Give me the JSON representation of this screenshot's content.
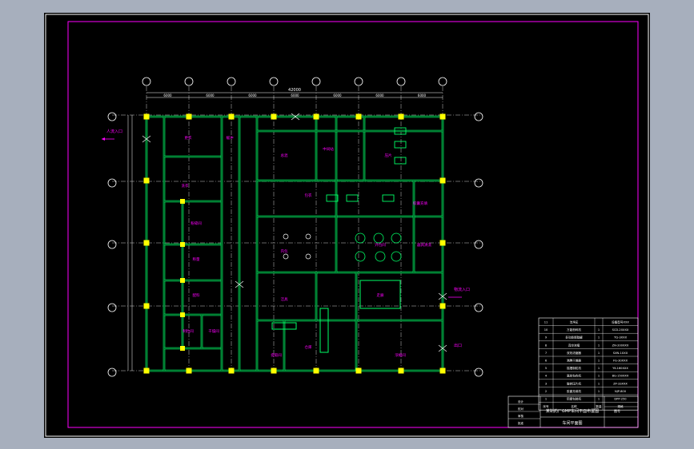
{
  "drawing": {
    "title_block": {
      "main_title": "某制药厂GMP车间平面布置图",
      "sub_title": "车间平面图",
      "sheet_label": "图号",
      "rows": [
        "设计",
        "校对",
        "审核",
        "批准"
      ]
    },
    "equipment_list": {
      "rows": [
        [
          "11",
          "洁净区",
          "",
          "设备型号XXX"
        ],
        [
          "10",
          "万能粉碎机",
          "1",
          "SCD-20XXX"
        ],
        [
          "9",
          "多功能提取罐",
          "1",
          "TQ-3XXX"
        ],
        [
          "8",
          "真空浓缩",
          "1",
          "ZN-200XXX"
        ],
        [
          "7",
          "双效浓缩器",
          "1",
          "SXN-1XXX"
        ],
        [
          "6",
          "沸腾干燥器",
          "1",
          "FG-30XXX"
        ],
        [
          "5",
          "摇摆制粒机",
          "1",
          "YK-160XXX"
        ],
        [
          "4",
          "高效包衣机",
          "1",
          "BG-150XXX"
        ],
        [
          "3",
          "旋转压片机",
          "1",
          "ZP-33XXX"
        ],
        [
          "2",
          "胶囊充填机",
          "1",
          "NJP-800"
        ],
        [
          "1",
          "铝塑包装机",
          "1",
          "DPP-250"
        ]
      ],
      "header": [
        "序号",
        "名称",
        "数量",
        "规格"
      ]
    },
    "rooms": [
      {
        "id": "r1",
        "label": "更衣"
      },
      {
        "id": "r2",
        "label": "缓冲"
      },
      {
        "id": "r3",
        "label": "洗衣"
      },
      {
        "id": "r4",
        "label": "粉碎间"
      },
      {
        "id": "r5",
        "label": "称量"
      },
      {
        "id": "r6",
        "label": "配料"
      },
      {
        "id": "r7",
        "label": "制粒间"
      },
      {
        "id": "r8",
        "label": "干燥间"
      },
      {
        "id": "r9",
        "label": "总混"
      },
      {
        "id": "r10",
        "label": "中间站"
      },
      {
        "id": "r11",
        "label": "压片"
      },
      {
        "id": "r12",
        "label": "包衣"
      },
      {
        "id": "r13",
        "label": "胶囊充填"
      },
      {
        "id": "r14",
        "label": "内包"
      },
      {
        "id": "r15",
        "label": "外包间"
      },
      {
        "id": "r16",
        "label": "器具清洗"
      },
      {
        "id": "r17",
        "label": "洁具"
      },
      {
        "id": "r18",
        "label": "走廊"
      },
      {
        "id": "r19",
        "label": "提取间"
      },
      {
        "id": "r20",
        "label": "浓缩间"
      },
      {
        "id": "r21",
        "label": "仓库"
      }
    ],
    "entrances": [
      {
        "id": "e1",
        "label": "人流入口"
      },
      {
        "id": "e2",
        "label": "物流入口"
      },
      {
        "id": "e3",
        "label": "出口"
      }
    ],
    "dimension_total": "42000",
    "dimension_bays": [
      "6000",
      "6000",
      "6000",
      "6000",
      "6000",
      "6000",
      "6000"
    ],
    "colors": {
      "background": "#000000",
      "frame": "#ff00ff",
      "axis": "#ffffff",
      "wall": "#00ff66",
      "column": "#ffff00",
      "text": "#ff00ff",
      "dim": "#ffffff"
    }
  }
}
